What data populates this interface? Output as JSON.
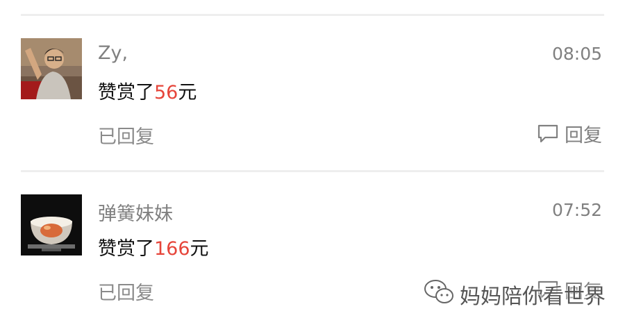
{
  "comments": [
    {
      "name": "Zy,",
      "time": "08:05",
      "reward_prefix": "赞赏了",
      "reward_amount": "56",
      "reward_suffix": "元",
      "status": "已回复",
      "reply_label": "回复"
    },
    {
      "name": "弹簧妹妹",
      "time": "07:52",
      "reward_prefix": "赞赏了",
      "reward_amount": "166",
      "reward_suffix": "元",
      "status": "已回复",
      "reply_label": "回复"
    }
  ],
  "watermark": {
    "text": "妈妈陪你看世界",
    "icon": "wechat-icon"
  },
  "colors": {
    "amount": "#e6453a",
    "secondary_text": "#808080",
    "divider": "#eeeeee"
  }
}
